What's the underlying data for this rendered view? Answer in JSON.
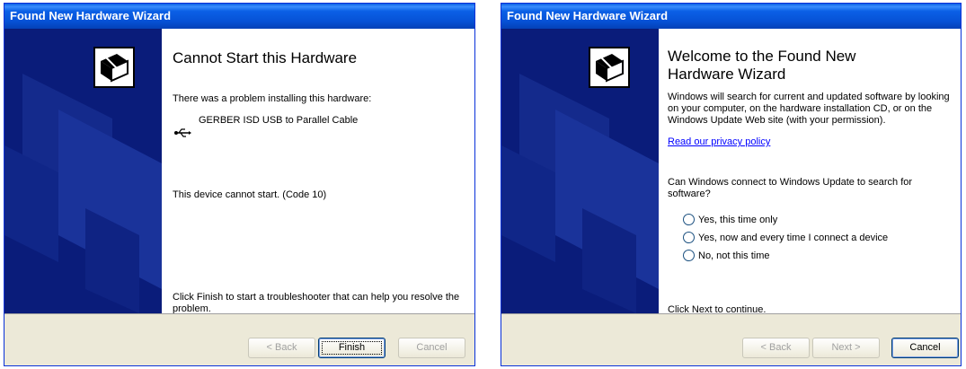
{
  "window_left": {
    "title": "Found New Hardware Wizard",
    "heading": "Cannot Start this Hardware",
    "problem_text": "There was a problem installing this hardware:",
    "device_name": "GERBER ISD USB to Parallel Cable",
    "device_icon": "usb-icon",
    "status_text": "This device cannot start. (Code 10)",
    "instruction_text": "Click Finish to start a troubleshooter that can help you resolve the problem.",
    "buttons": {
      "back": "< Back",
      "finish": "Finish",
      "cancel": "Cancel"
    }
  },
  "window_right": {
    "title": "Found New Hardware Wizard",
    "heading_line1": "Welcome to the Found New",
    "heading_line2": "Hardware Wizard",
    "intro_text": "Windows will search for current and updated software by looking on your computer, on the hardware installation CD, or on the Windows Update Web site (with your permission).",
    "privacy_link": "Read our privacy policy",
    "question_text": "Can Windows connect to Windows Update to search for software?",
    "options": [
      "Yes, this time only",
      "Yes, now and every time I connect a device",
      "No, not this time"
    ],
    "footer_text": "Click Next to continue.",
    "buttons": {
      "back": "< Back",
      "next": "Next >",
      "cancel": "Cancel"
    }
  }
}
